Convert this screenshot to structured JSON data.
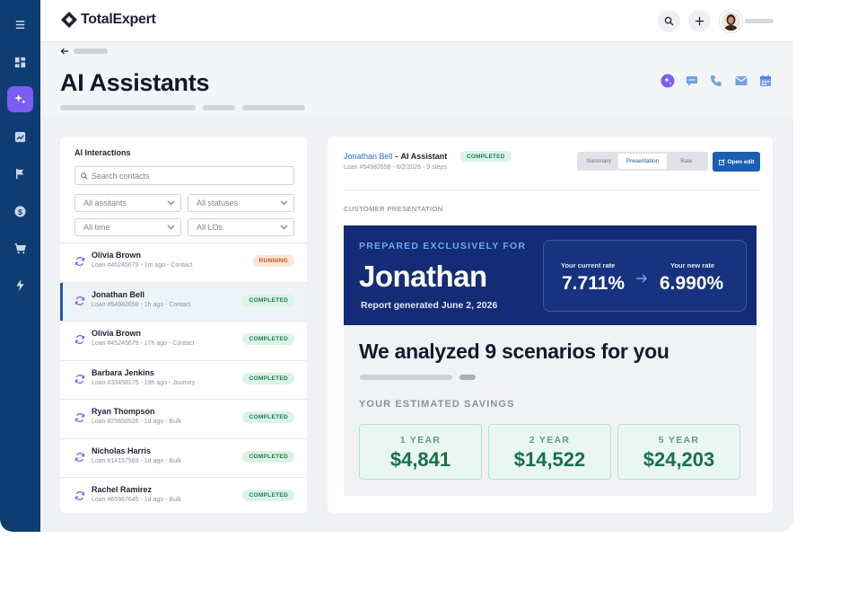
{
  "app": {
    "logo_text": "TotalExpert"
  },
  "rail": {
    "items": [
      "menu-icon",
      "dashboard-icon",
      "ai-sparkle-icon",
      "analytics-icon",
      "flag-icon",
      "dollar-icon",
      "cart-icon",
      "bolt-icon"
    ],
    "active": "ai-sparkle-icon"
  },
  "page": {
    "title": "AI Assistants"
  },
  "interactions": {
    "title": "AI Interactions",
    "search_placeholder": "Search contacts",
    "filters": {
      "assistants": "All assitants",
      "statuses": "All statuses",
      "time": "All time",
      "los": "All LOs"
    },
    "rows": [
      {
        "name": "Olivia Brown",
        "sub": "Loan  #45245679 - 1m ago - Contact",
        "status": "RUNNING"
      },
      {
        "name": "Jonathan Bell",
        "sub": "Loan  #54982658 - 1h ago - Contact",
        "status": "COMPLETED"
      },
      {
        "name": "Olivia Brown",
        "sub": "Loan  #45245679 - 17h ago - Contact",
        "status": "COMPLETED"
      },
      {
        "name": "Barbara Jenkins",
        "sub": "Loan  #33458175 - 19h ago - Journey",
        "status": "COMPLETED"
      },
      {
        "name": "Ryan Thompson",
        "sub": "Loan  #25658526 - 1d ago - Bulk",
        "status": "COMPLETED"
      },
      {
        "name": "Nicholas Harris",
        "sub": "Loan  #14157569 - 1d ago - Bulk",
        "status": "COMPLETED"
      },
      {
        "name": "Rachel Ramirez",
        "sub": "Loan  #65987645 - 1d ago - Bulk",
        "status": "COMPLETED"
      }
    ]
  },
  "detail": {
    "contact": "Jonathan Bell",
    "separator": "-",
    "assistant": "AI  Assistant",
    "status": "COMPLETED",
    "sub": "Loan  #54982658 - 6/2/2026 - 9 steps",
    "tabs": [
      "Summary",
      "Presentation",
      "Raw"
    ],
    "active_tab": "Presentation",
    "open_edit": "Open edit",
    "section_label": "CUSTOMER PRESENTATION"
  },
  "presentation": {
    "prepared": "PREPARED EXCLUSIVELY FOR",
    "first_name": "Jonathan",
    "generated": "Report generated June 2, 2026",
    "current_rate_label": "Your current rate",
    "current_rate": "7.711%",
    "new_rate_label": "Your new rate",
    "new_rate": "6.990%",
    "analyzed": "We analyzed 9 scenarios for you",
    "savings_label": "YOUR ESTIMATED SAVINGS",
    "savings": [
      {
        "label": "1 YEAR",
        "value": "$4,841"
      },
      {
        "label": "2 YEAR",
        "value": "$14,522"
      },
      {
        "label": "5 YEAR",
        "value": "$24,203"
      }
    ]
  },
  "colors": {
    "rail": "#0f3d73",
    "accent": "#7b5cf5",
    "hero": "#132c75",
    "primary_button": "#1a5fb4",
    "completed": "#1c7a4b",
    "running": "#c0551f"
  }
}
